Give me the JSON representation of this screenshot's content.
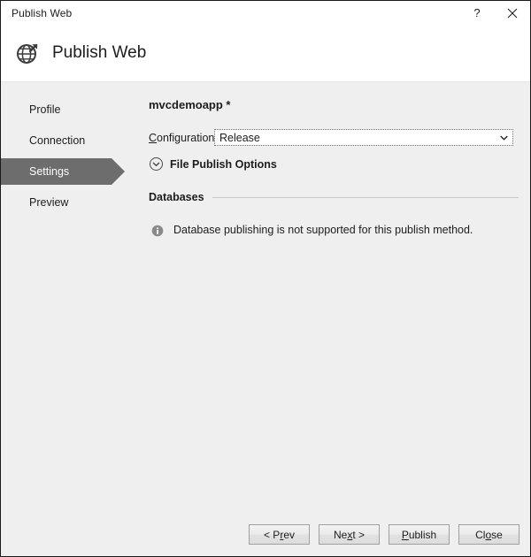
{
  "window": {
    "title": "Publish Web",
    "help_label": "?",
    "close_label": "✕"
  },
  "header": {
    "title": "Publish Web",
    "icon": "globe-publish-icon"
  },
  "sidebar": {
    "items": [
      {
        "label": "Profile",
        "selected": false
      },
      {
        "label": "Connection",
        "selected": false
      },
      {
        "label": "Settings",
        "selected": true
      },
      {
        "label": "Preview",
        "selected": false
      }
    ]
  },
  "content": {
    "app_name": "mvcdemoapp *",
    "configuration": {
      "label_prefix": "",
      "label_accesskey": "C",
      "label_suffix": "onfiguration:",
      "value": "Release",
      "arrow_icon": "chevron-down-icon"
    },
    "file_publish_options": {
      "label": "File Publish Options",
      "expander_icon": "chevron-down-circle-icon"
    },
    "databases": {
      "section_title": "Databases",
      "info_icon": "info-icon",
      "message": "Database publishing is not supported for this publish method."
    }
  },
  "footer": {
    "buttons": [
      {
        "name": "prev",
        "before": "< P",
        "accesskey": "r",
        "after": "ev"
      },
      {
        "name": "next",
        "before": "Ne",
        "accesskey": "x",
        "after": "t >"
      },
      {
        "name": "publish",
        "before": "",
        "accesskey": "P",
        "after": "ublish"
      },
      {
        "name": "close",
        "before": "Cl",
        "accesskey": "o",
        "after": "se"
      }
    ]
  },
  "colors": {
    "selected_nav": "#6d6d6d",
    "body_bg": "#efefef",
    "header_bg": "#ffffff",
    "text": "#1d1d1d"
  }
}
